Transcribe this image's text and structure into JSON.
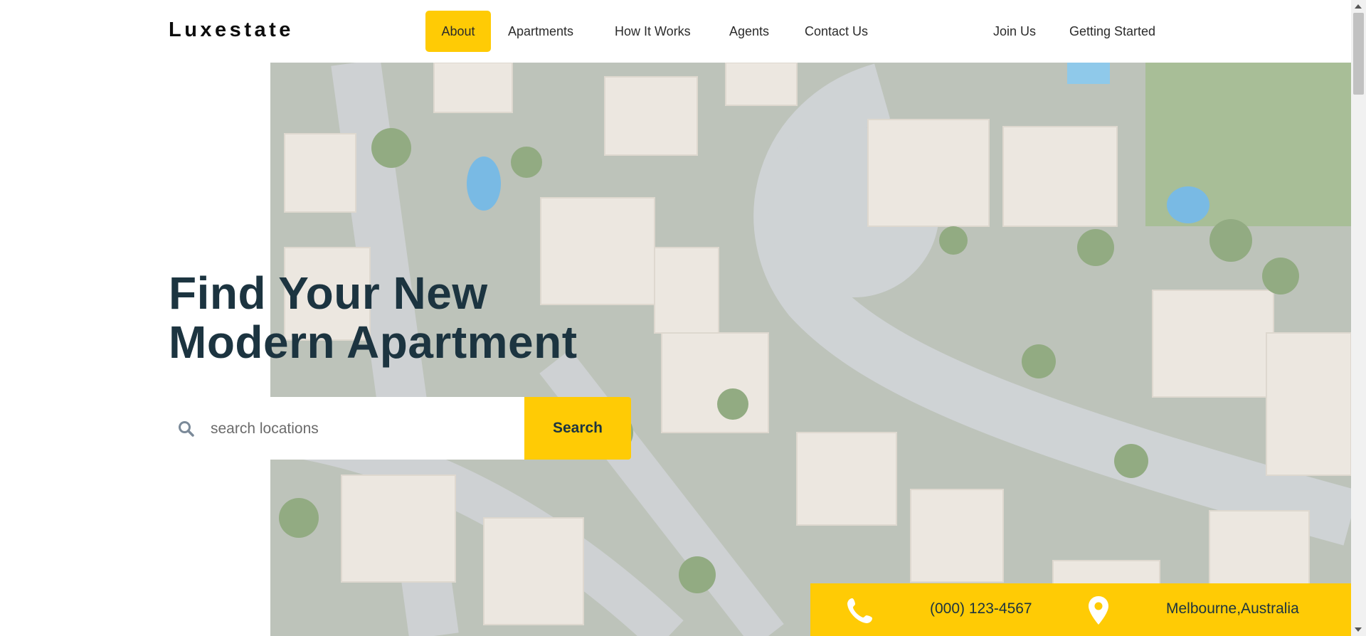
{
  "brand": {
    "name": "Luxestate"
  },
  "nav": {
    "items": [
      {
        "label": "About",
        "active": true
      },
      {
        "label": "Apartments"
      },
      {
        "label": "How It Works"
      },
      {
        "label": "Agents"
      },
      {
        "label": "Contact Us"
      }
    ],
    "right_items": [
      {
        "label": "Join Us"
      },
      {
        "label": "Getting Started"
      }
    ]
  },
  "hero": {
    "headline_line1": "Find Your New",
    "headline_line2": "Modern Apartment",
    "search": {
      "placeholder": "search locations",
      "value": "",
      "icon": "search-icon",
      "button_label": "Search"
    }
  },
  "contact": {
    "phone": "(000) 123-4567",
    "phone_icon": "phone-icon",
    "location": "Melbourne,Australia",
    "location_icon": "map-pin-icon"
  },
  "colors": {
    "accent": "#ffcb05",
    "heading": "#1c3440",
    "text": "#2b2b2b"
  }
}
